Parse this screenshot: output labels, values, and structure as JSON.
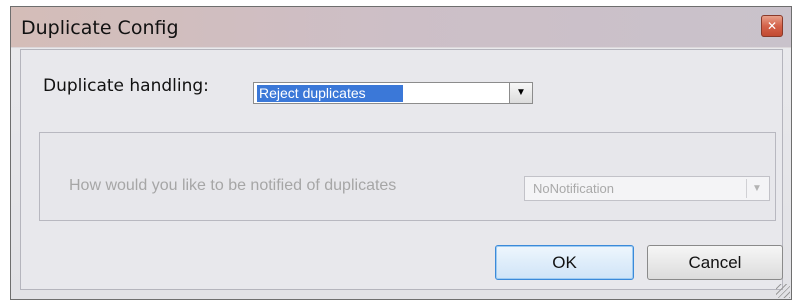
{
  "window": {
    "title": "Duplicate Config",
    "close_icon": "close-icon"
  },
  "duplicate_handling": {
    "label": "Duplicate handling:",
    "value": "Reject duplicates"
  },
  "notification": {
    "label": "How would you like to be notified of duplicates",
    "value": "NoNotification",
    "enabled": false
  },
  "buttons": {
    "ok": "OK",
    "cancel": "Cancel"
  },
  "colors": {
    "selection": "#3b78d8",
    "close_button": "#d4624a",
    "default_button_border": "#3b8ad9",
    "disabled_text": "#a6a6a6"
  }
}
